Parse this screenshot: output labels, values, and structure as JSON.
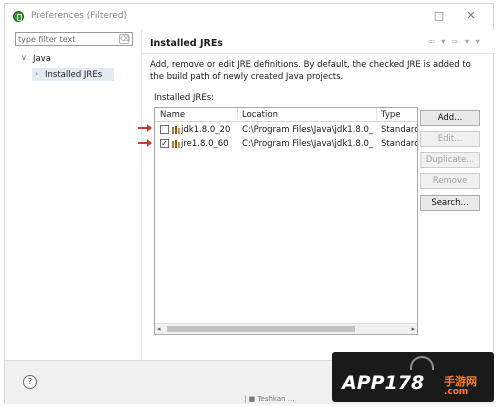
{
  "window": {
    "title": "Preferences (Filtered)",
    "minimize_glyph": "☐",
    "restore_glyph": "□",
    "close_glyph": "✕"
  },
  "left": {
    "filter_placeholder": "type filter text",
    "tree": [
      {
        "label": "Java",
        "arrow": "∨"
      },
      {
        "label": "Installed JREs",
        "arrow": "›"
      }
    ]
  },
  "page": {
    "title": "Installed JREs",
    "description": "Add, remove or edit JRE definitions. By default, the checked JRE is added to the build path of newly created Java projects.",
    "list_label": "Installed JREs:",
    "nav_glyphs": "⇦ ▾ ⇨ ▾ ▾"
  },
  "table": {
    "columns": [
      "Name",
      "Location",
      "Type"
    ],
    "rows": [
      {
        "checked": false,
        "check_glyph": "",
        "name": "jdk1.8.0_20",
        "location": "C:\\Program Files\\Java\\jdk1.8.0_...",
        "type": "Standarc"
      },
      {
        "checked": true,
        "check_glyph": "✓",
        "name": "jre1.8.0_60",
        "location": "C:\\Program Files\\Java\\jdk1.8.0_...",
        "type": "Standarc"
      }
    ],
    "scroll_left": "◂",
    "scroll_right": "▸"
  },
  "buttons": {
    "add": "Add...",
    "edit": "Edit...",
    "duplicate": "Duplicate...",
    "remove": "Remove",
    "search": "Search..."
  },
  "footer": {
    "help_glyph": "?",
    "taskbar_text": "| ■ Teshkan ..."
  },
  "watermark": {
    "logo": "APP178",
    "cn": "手游网",
    "domain": ".com"
  },
  "colors": {
    "annotation_arrow": "#d23a2a",
    "jre_icon": "#b07a2a",
    "watermark_orange": "#ff7b2a"
  }
}
